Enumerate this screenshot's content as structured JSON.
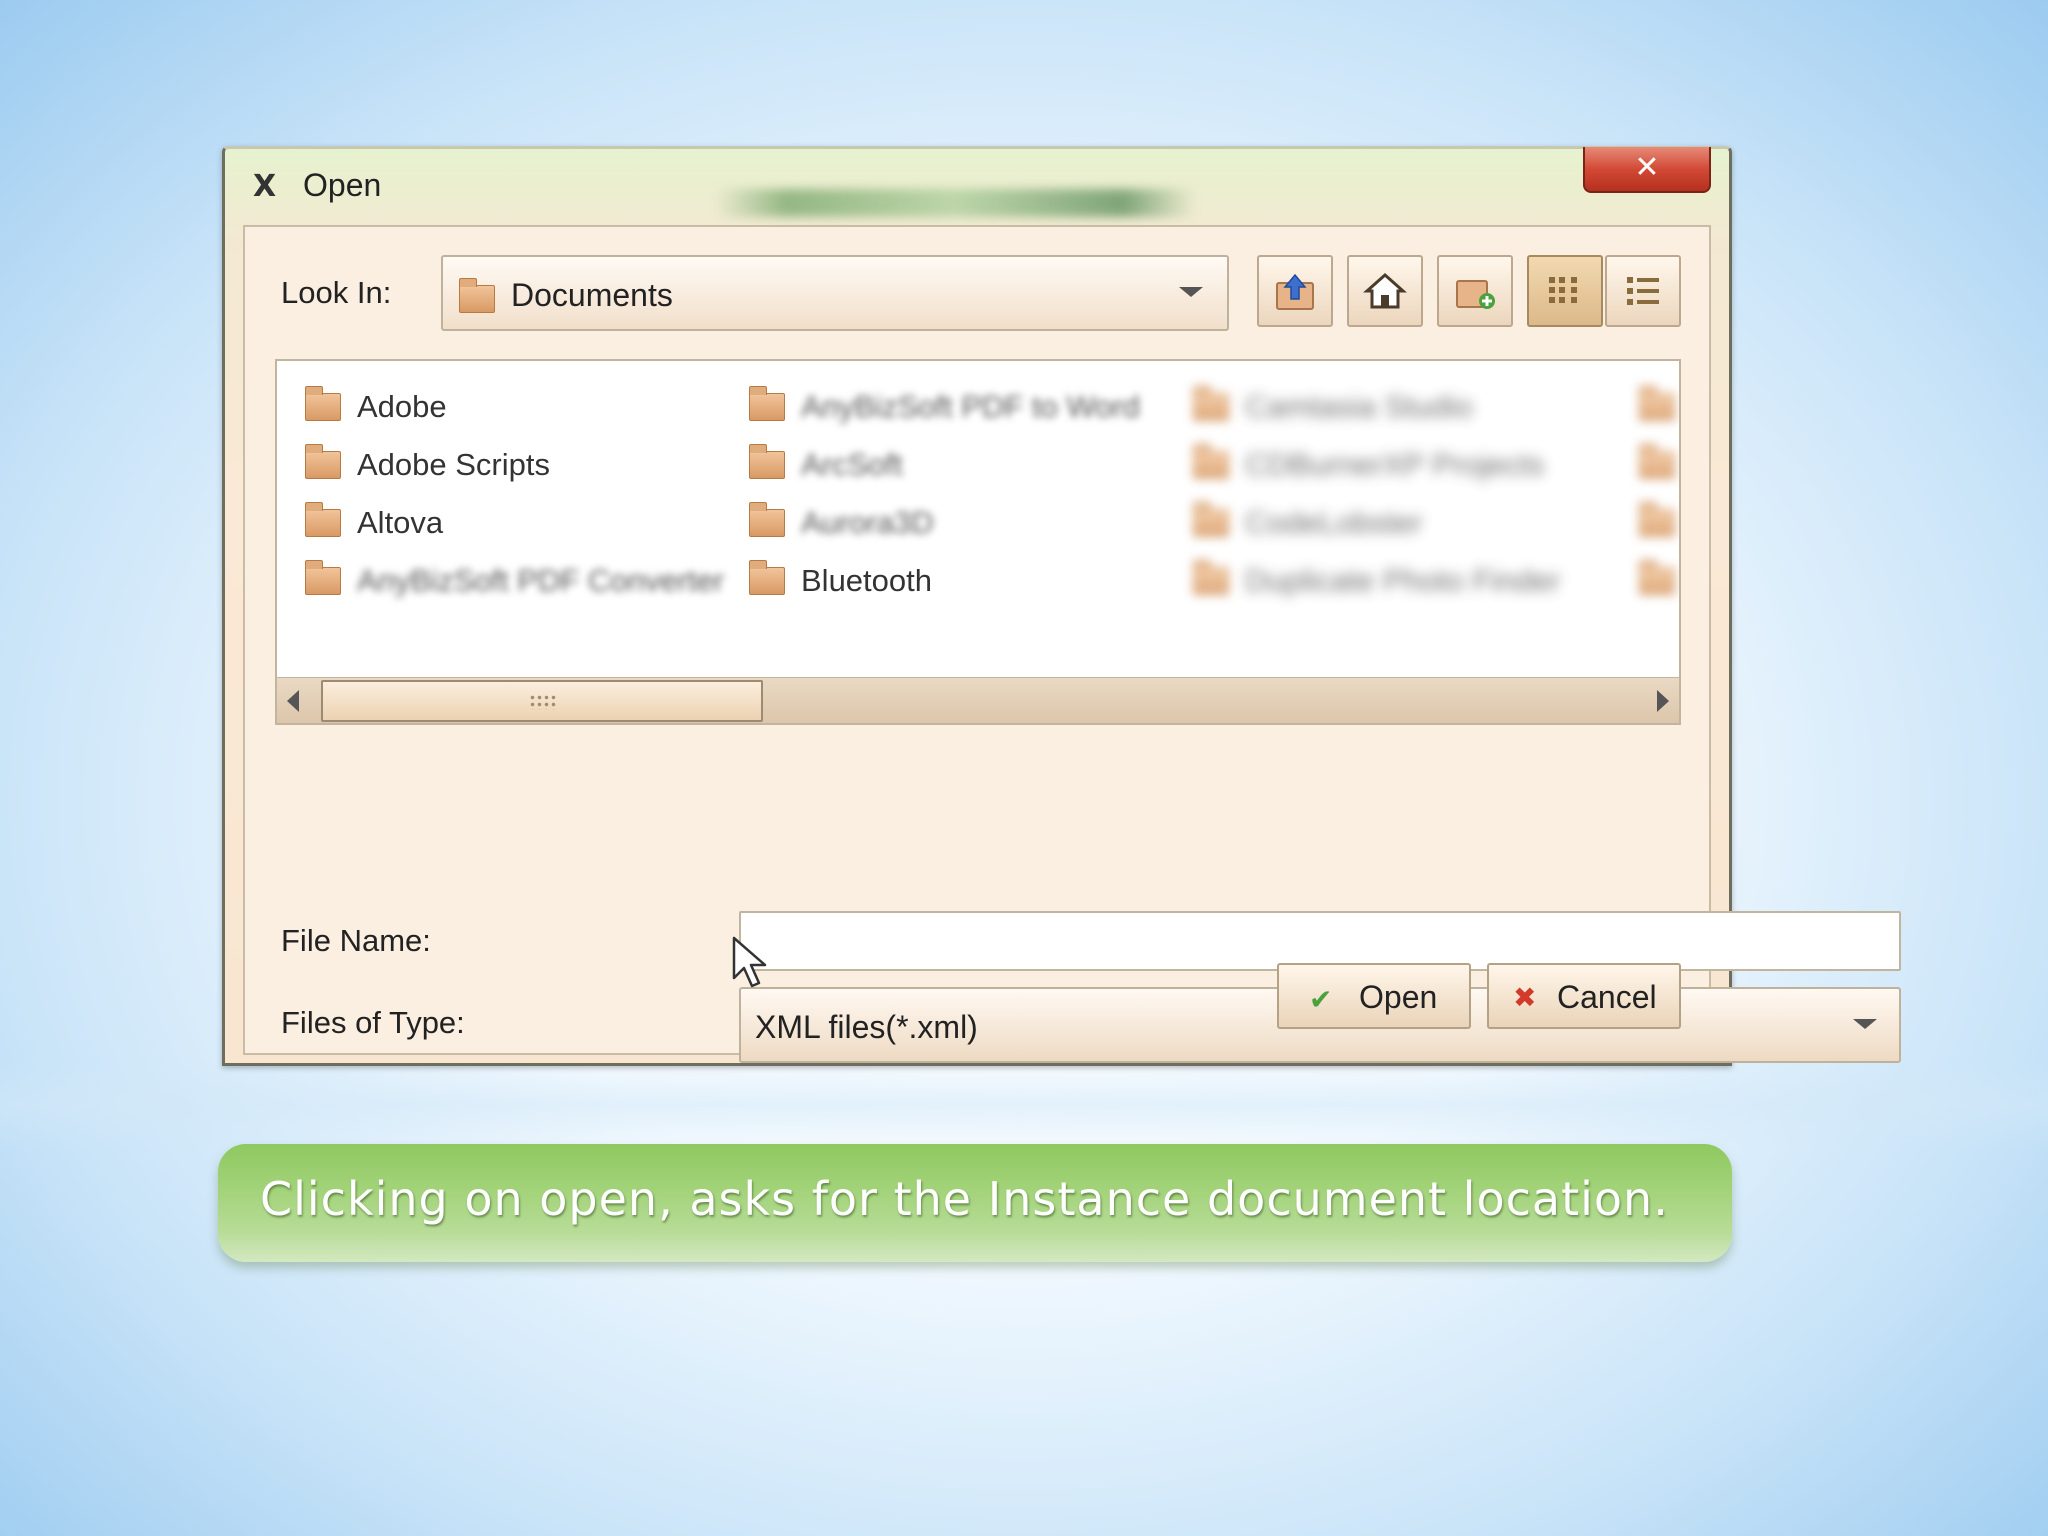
{
  "dialog": {
    "title": "Open",
    "title_icon": "X",
    "close_label": "✕",
    "look_in": {
      "label": "Look In:",
      "value": "Documents"
    },
    "toolbar": {
      "up_icon": "up-folder-icon",
      "home_icon": "home-icon",
      "new_folder_icon": "new-folder-icon",
      "list_view_icon": "list-view-icon",
      "details_view_icon": "details-view-icon"
    },
    "files": {
      "column1": [
        "Adobe",
        "Adobe Scripts",
        "Altova",
        "AnyBizSoft PDF Converter"
      ],
      "column2": [
        "AnyBizSoft PDF to Word",
        "ArcSoft",
        "Aurora3D",
        "Bluetooth"
      ],
      "column3": [
        "Camtasia Studio",
        "CDBurnerXP Projects",
        "CodeLobster",
        "Duplicate Photo Finder"
      ]
    },
    "file_name": {
      "label": "File Name:",
      "value": ""
    },
    "files_of_type": {
      "label": "Files of Type:",
      "value": "XML files(*.xml)"
    },
    "buttons": {
      "open": "Open",
      "cancel": "Cancel"
    }
  },
  "caption": "Clicking on open,  asks for the Instance document location.",
  "colors": {
    "caption_green": "#8fc860",
    "close_red": "#d24a36",
    "dialog_bg": "#fbefe2"
  }
}
